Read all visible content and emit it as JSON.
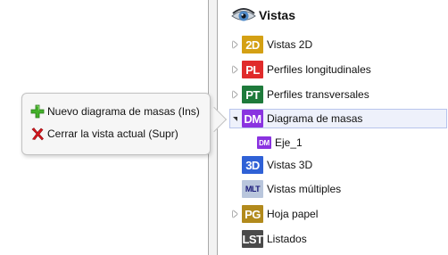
{
  "tree": {
    "title": "Vistas",
    "nodes": [
      {
        "badge": "2D",
        "label": "Vistas 2D",
        "expander": "collapsed",
        "color": "#d4a014"
      },
      {
        "badge": "PL",
        "label": "Perfiles longitudinales",
        "expander": "collapsed",
        "color": "#e02b2b"
      },
      {
        "badge": "PT",
        "label": "Perfiles transversales",
        "expander": "collapsed",
        "color": "#1e7a3b"
      },
      {
        "badge": "DM",
        "label": "Diagrama de masas",
        "expander": "expanded",
        "color": "#8a33e0",
        "selected": true
      },
      {
        "badge": "DM",
        "label": "Eje_1",
        "expander": "none",
        "color": "#8a33e0"
      },
      {
        "badge": "3D",
        "label": "Vistas 3D",
        "expander": "none",
        "color": "#2f61d6"
      },
      {
        "badge": "MLT",
        "label": "Vistas múltiples",
        "expander": "none",
        "color": "#b9c6dc"
      },
      {
        "badge": "PG",
        "label": "Hoja papel",
        "expander": "collapsed",
        "color": "#b28a1c"
      },
      {
        "badge": "LST",
        "label": "Listados",
        "expander": "none",
        "color": "#4a4a4a"
      }
    ]
  },
  "popup": {
    "items": [
      {
        "icon": "plus-icon",
        "label": "Nuevo diagrama de masas (Ins)"
      },
      {
        "icon": "x-icon",
        "label": "Cerrar la vista actual (Supr)"
      }
    ]
  }
}
